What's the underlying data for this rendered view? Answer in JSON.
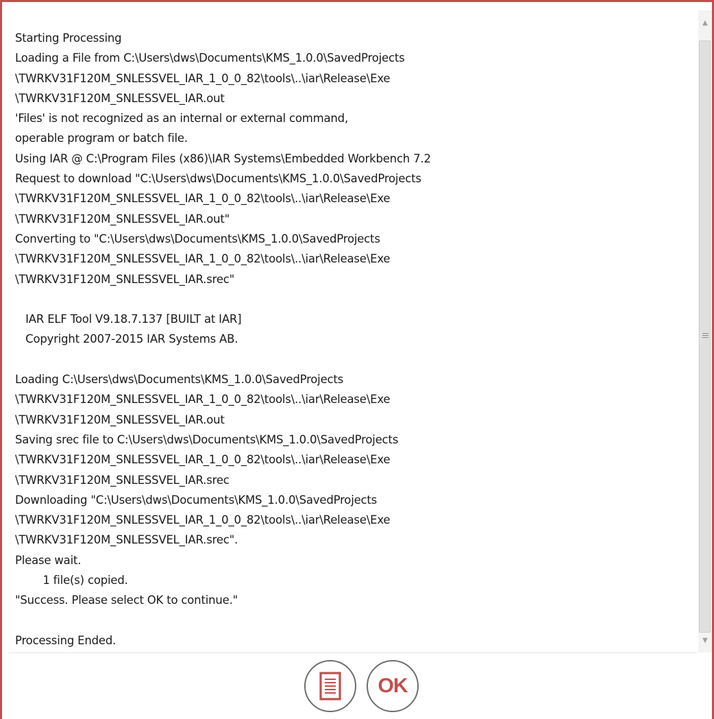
{
  "log": {
    "lines": [
      "Starting Processing",
      "Loading a File from C:\\Users\\dws\\Documents\\KMS_1.0.0\\SavedProjects",
      "\\TWRKV31F120M_SNLESSVEL_IAR_1_0_0_82\\tools\\..\\iar\\Release\\Exe",
      "\\TWRKV31F120M_SNLESSVEL_IAR.out",
      "'Files' is not recognized as an internal or external command,",
      "operable program or batch file.",
      "Using IAR @ C:\\Program Files (x86)\\IAR Systems\\Embedded Workbench 7.2",
      "Request to download \"C:\\Users\\dws\\Documents\\KMS_1.0.0\\SavedProjects",
      "\\TWRKV31F120M_SNLESSVEL_IAR_1_0_0_82\\tools\\..\\iar\\Release\\Exe",
      "\\TWRKV31F120M_SNLESSVEL_IAR.out\"",
      "Converting to \"C:\\Users\\dws\\Documents\\KMS_1.0.0\\SavedProjects",
      "\\TWRKV31F120M_SNLESSVEL_IAR_1_0_0_82\\tools\\..\\iar\\Release\\Exe",
      "\\TWRKV31F120M_SNLESSVEL_IAR.srec\"",
      "",
      "   IAR ELF Tool V9.18.7.137 [BUILT at IAR]",
      "   Copyright 2007-2015 IAR Systems AB.",
      "",
      "Loading C:\\Users\\dws\\Documents\\KMS_1.0.0\\SavedProjects",
      "\\TWRKV31F120M_SNLESSVEL_IAR_1_0_0_82\\tools\\..\\iar\\Release\\Exe",
      "\\TWRKV31F120M_SNLESSVEL_IAR.out",
      "Saving srec file to C:\\Users\\dws\\Documents\\KMS_1.0.0\\SavedProjects",
      "\\TWRKV31F120M_SNLESSVEL_IAR_1_0_0_82\\tools\\..\\iar\\Release\\Exe",
      "\\TWRKV31F120M_SNLESSVEL_IAR.srec",
      "Downloading \"C:\\Users\\dws\\Documents\\KMS_1.0.0\\SavedProjects",
      "\\TWRKV31F120M_SNLESSVEL_IAR_1_0_0_82\\tools\\..\\iar\\Release\\Exe",
      "\\TWRKV31F120M_SNLESSVEL_IAR.srec\".",
      "Please wait.",
      "        1 file(s) copied.",
      "\"Success. Please select OK to continue.\"",
      "",
      "Processing Ended."
    ]
  },
  "buttons": {
    "ok_label": "OK",
    "log_icon": "document-list-icon"
  },
  "scrollbar": {
    "up_icon": "scroll-up-arrow-icon",
    "down_icon": "scroll-down-arrow-icon"
  },
  "colors": {
    "accent": "#c0504d",
    "text": "#1a1a1a",
    "button_border": "#6e6e6e"
  }
}
